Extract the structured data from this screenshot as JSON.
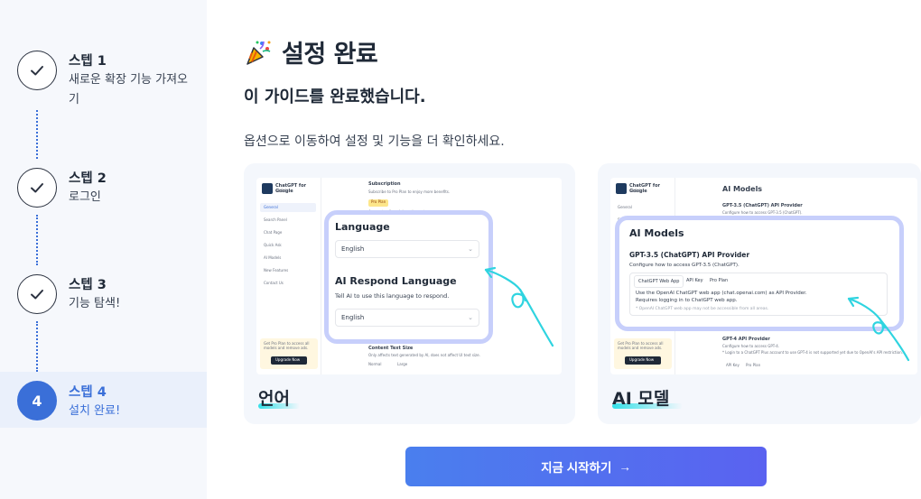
{
  "sidebar": {
    "steps": [
      {
        "title": "스텝 1",
        "desc": "새로운 확장 기능 가져오기",
        "number": "1",
        "state": "done"
      },
      {
        "title": "스텝 2",
        "desc": "로그인",
        "number": "2",
        "state": "done"
      },
      {
        "title": "스텝 3",
        "desc": "기능 탐색!",
        "number": "3",
        "state": "done"
      },
      {
        "title": "스텝 4",
        "desc": "설치 완료!",
        "number": "4",
        "state": "active"
      }
    ]
  },
  "main": {
    "title": "설정 완료",
    "subtitle": "이 가이드를 완료했습니다.",
    "description": "옵션으로 이동하여 설정 및 기능을 더 확인하세요.",
    "cards": [
      {
        "label": "언어",
        "preview": {
          "app_name": "ChatGPT for Google",
          "app_sub": "v4.2.0",
          "nav": [
            "General",
            "Search Panel",
            "Chat Page",
            "Quick Ask",
            "AI Models",
            "New Features",
            "Contact Us"
          ],
          "section": "Subscription",
          "section_note": "Subscribe to Pro Plan to enjoy more benefits.",
          "plan_badge": "Pro Plan",
          "plan_note": "Access to all models and agents",
          "language_title": "Language",
          "language_value": "English",
          "respond_title": "AI Respond Language",
          "respond_note": "Tell AI to use this language to respond.",
          "respond_value": "English",
          "font_title": "Content Text Size",
          "font_note": "Only affects text generated by AI, does not affect UI text size.",
          "font_opts": [
            "Normal",
            "Large"
          ],
          "promo": "Get Pro Plan to access all models and remove ads.",
          "promo_btn": "Upgrade Now"
        }
      },
      {
        "label": "AI 모델",
        "preview": {
          "app_name": "ChatGPT for Google",
          "app_sub": "v4.2.0",
          "nav": [
            "General",
            "Search Panel",
            "Chat Page",
            "Quick Ask",
            "AI Models",
            "New Features",
            "Contact Us"
          ],
          "bg_title": "AI Models",
          "bg_provider": "GPT-3.5 (ChatGPT) API Provider",
          "bg_provider_note": "Configure how to access GPT-3.5 (ChatGPT).",
          "popup_title": "AI Models",
          "popup_provider": "GPT-3.5 (ChatGPT) API Provider",
          "popup_note": "Configure how to access GPT-3.5 (ChatGPT).",
          "tabs": [
            "ChatGPT Web App",
            "API Key",
            "Pro Plan"
          ],
          "body1": "Use the OpenAI ChatGPT web app (chat.openai.com) as API Provider.",
          "body2": "Requires logging in to ChatGPT web app.",
          "body3": "* OpenAI ChatGPT web app may not be accessible from all areas.",
          "gpt4_title": "GPT-4 API Provider",
          "gpt4_note": "Configure how to access GPT-4.",
          "gpt4_note2": "* Login to a ChatGPT Plus account to use GPT-4 is not supported yet due to OpenAI's API restriction.",
          "gpt4_tabs": [
            "API Key",
            "Pro Plan"
          ],
          "promo": "Get Pro Plan to access all models and remove ads.",
          "promo_btn": "Upgrade Now"
        }
      }
    ],
    "cta_label": "지금 시작하기",
    "cta_arrow": "→"
  },
  "colors": {
    "accent": "#3a6fd8",
    "sidebar_bg": "#f6f8fc",
    "popup_border": "#c7cffb",
    "cta_start": "#4a7fee",
    "cta_end": "#5a62f0",
    "highlight": "#34e0e8"
  },
  "icons": [
    "check-icon",
    "party-popper-icon",
    "arrow-right-icon",
    "chevron-down-icon",
    "curly-arrow-icon"
  ]
}
